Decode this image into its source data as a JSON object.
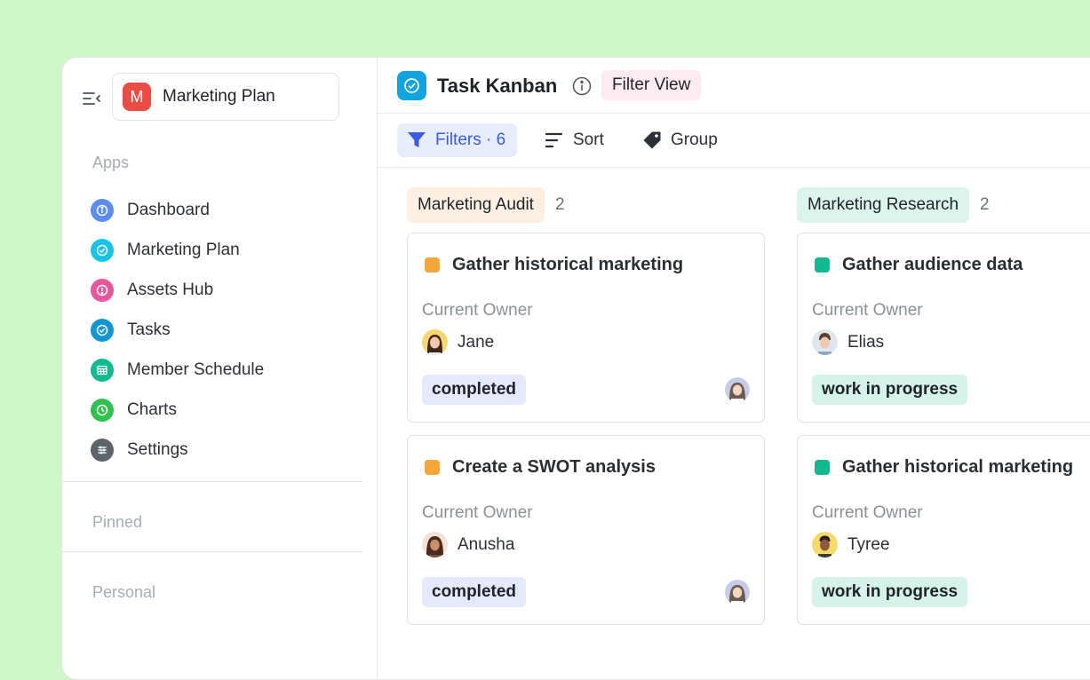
{
  "workspace": {
    "initial": "M",
    "name": "Marketing Plan",
    "color": "#ec4b45"
  },
  "sidebar": {
    "apps_label": "Apps",
    "items": [
      {
        "label": "Dashboard",
        "icon": "info-icon",
        "color": "#5b8def"
      },
      {
        "label": "Marketing Plan",
        "icon": "check-circle-icon",
        "color": "#19c3e6"
      },
      {
        "label": "Assets  Hub",
        "icon": "info-icon",
        "color": "#e8579a"
      },
      {
        "label": "Tasks",
        "icon": "check-circle-icon",
        "color": "#1296d1"
      },
      {
        "label": "Member Schedule",
        "icon": "grid-icon",
        "color": "#16b88f"
      },
      {
        "label": "Charts",
        "icon": "clock-icon",
        "color": "#2fc04f"
      },
      {
        "label": "Settings",
        "icon": "sliders-icon",
        "color": "#5d646c"
      }
    ],
    "pinned_label": "Pinned",
    "personal_label": "Personal"
  },
  "header": {
    "title": "Task Kanban",
    "view_badge": "Filter View"
  },
  "toolbar": {
    "filters_label": "Filters · 6",
    "sort_label": "Sort",
    "group_label": "Group"
  },
  "board": {
    "columns": [
      {
        "title": "Marketing Audit",
        "count": "2",
        "color": "#fdf0e2",
        "cards": [
          {
            "title": "Gather historical marketing",
            "owner_label": "Current Owner",
            "owner": "Jane",
            "status": "completed",
            "status_color": "#e6e9fb",
            "dot_color": "#f7a53b"
          },
          {
            "title": "Create a SWOT analysis",
            "owner_label": "Current Owner",
            "owner": "Anusha",
            "status": "completed",
            "status_color": "#e6e9fb",
            "dot_color": "#f7a53b"
          }
        ]
      },
      {
        "title": "Marketing Research",
        "count": "2",
        "color": "#dcf5ec",
        "cards": [
          {
            "title": "Gather audience data",
            "owner_label": "Current Owner",
            "owner": "Elias",
            "status": "work in progress",
            "status_color": "#d5f3e9",
            "dot_color": "#14b890"
          },
          {
            "title": "Gather historical marketing",
            "owner_label": "Current Owner",
            "owner": "Tyree",
            "status": "work in progress",
            "status_color": "#d5f3e9",
            "dot_color": "#14b890"
          }
        ]
      }
    ]
  }
}
